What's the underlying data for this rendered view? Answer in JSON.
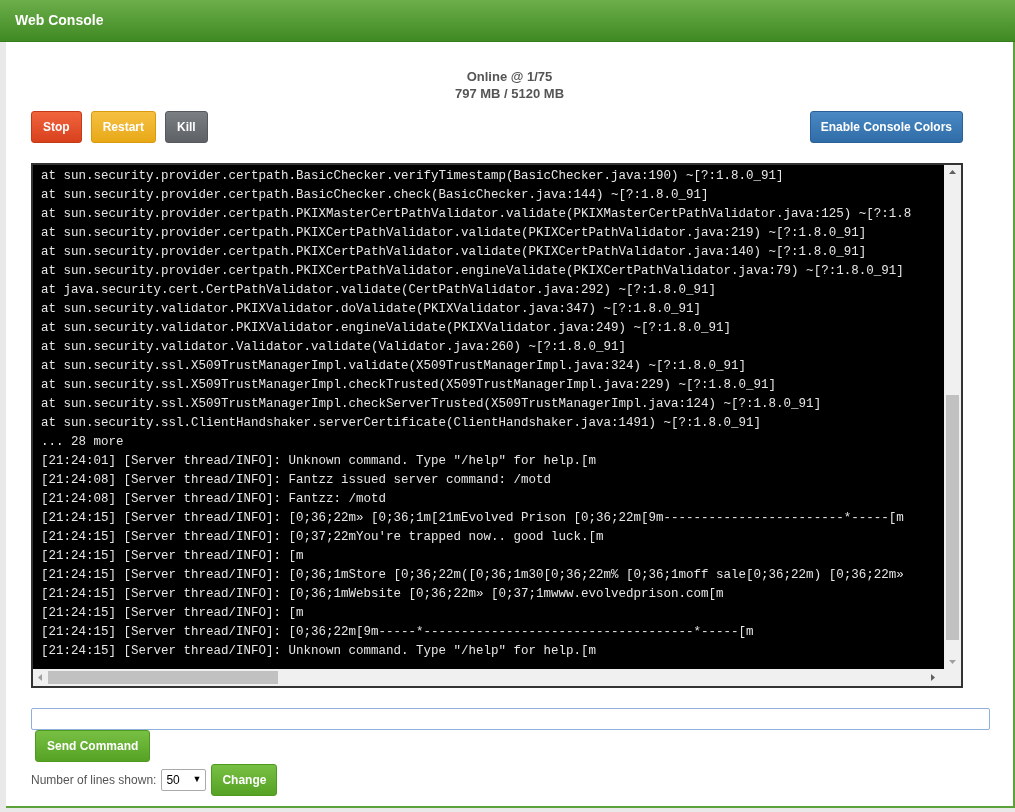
{
  "window": {
    "title": "Web Console"
  },
  "status": {
    "online": "Online @ 1/75",
    "memory": "797 MB / 5120 MB"
  },
  "actions": [
    {
      "label": "Stop",
      "kind": "danger"
    },
    {
      "label": "Restart",
      "kind": "warning"
    },
    {
      "label": "Kill",
      "kind": "neutral"
    }
  ],
  "color_toggle": {
    "label": "Enable Console Colors",
    "kind": "primary"
  },
  "console_lines": [
    "at sun.security.provider.certpath.BasicChecker.verifyTimestamp(BasicChecker.java:190) ~[?:1.8.0_91]",
    "at sun.security.provider.certpath.BasicChecker.check(BasicChecker.java:144) ~[?:1.8.0_91]",
    "at sun.security.provider.certpath.PKIXMasterCertPathValidator.validate(PKIXMasterCertPathValidator.java:125) ~[?:1.8",
    "at sun.security.provider.certpath.PKIXCertPathValidator.validate(PKIXCertPathValidator.java:219) ~[?:1.8.0_91]",
    "at sun.security.provider.certpath.PKIXCertPathValidator.validate(PKIXCertPathValidator.java:140) ~[?:1.8.0_91]",
    "at sun.security.provider.certpath.PKIXCertPathValidator.engineValidate(PKIXCertPathValidator.java:79) ~[?:1.8.0_91]",
    "at java.security.cert.CertPathValidator.validate(CertPathValidator.java:292) ~[?:1.8.0_91]",
    "at sun.security.validator.PKIXValidator.doValidate(PKIXValidator.java:347) ~[?:1.8.0_91]",
    "at sun.security.validator.PKIXValidator.engineValidate(PKIXValidator.java:249) ~[?:1.8.0_91]",
    "at sun.security.validator.Validator.validate(Validator.java:260) ~[?:1.8.0_91]",
    "at sun.security.ssl.X509TrustManagerImpl.validate(X509TrustManagerImpl.java:324) ~[?:1.8.0_91]",
    "at sun.security.ssl.X509TrustManagerImpl.checkTrusted(X509TrustManagerImpl.java:229) ~[?:1.8.0_91]",
    "at sun.security.ssl.X509TrustManagerImpl.checkServerTrusted(X509TrustManagerImpl.java:124) ~[?:1.8.0_91]",
    "at sun.security.ssl.ClientHandshaker.serverCertificate(ClientHandshaker.java:1491) ~[?:1.8.0_91]",
    "... 28 more",
    "[21:24:01] [Server thread/INFO]: Unknown command. Type \"/help\" for help.[m",
    "[21:24:08] [Server thread/INFO]: Fantzz issued server command: /motd",
    "[21:24:08] [Server thread/INFO]: Fantzz: /motd",
    "[21:24:15] [Server thread/INFO]: [0;36;22m» [0;36;1m[21mEvolved Prison [0;36;22m[9m------------------------*-----[m",
    "[21:24:15] [Server thread/INFO]: [0;37;22mYou're trapped now.. good luck.[m",
    "[21:24:15] [Server thread/INFO]: [m",
    "[21:24:15] [Server thread/INFO]: [0;36;1mStore [0;36;22m([0;36;1m30[0;36;22m% [0;36;1moff sale[0;36;22m) [0;36;22m»",
    "[21:24:15] [Server thread/INFO]: [0;36;1mWebsite [0;36;22m» [0;37;1mwww.evolvedprison.com[m",
    "[21:24:15] [Server thread/INFO]: [m",
    "[21:24:15] [Server thread/INFO]: [0;36;22m[9m-----*------------------------------------*-----[m",
    "[21:24:15] [Server thread/INFO]: Unknown command. Type \"/help\" for help.[m"
  ],
  "send_button": {
    "label": "Send Command"
  },
  "lines_setting": {
    "label": "Number of lines shown:",
    "value": "50",
    "caret": "▼",
    "button": "Change"
  }
}
